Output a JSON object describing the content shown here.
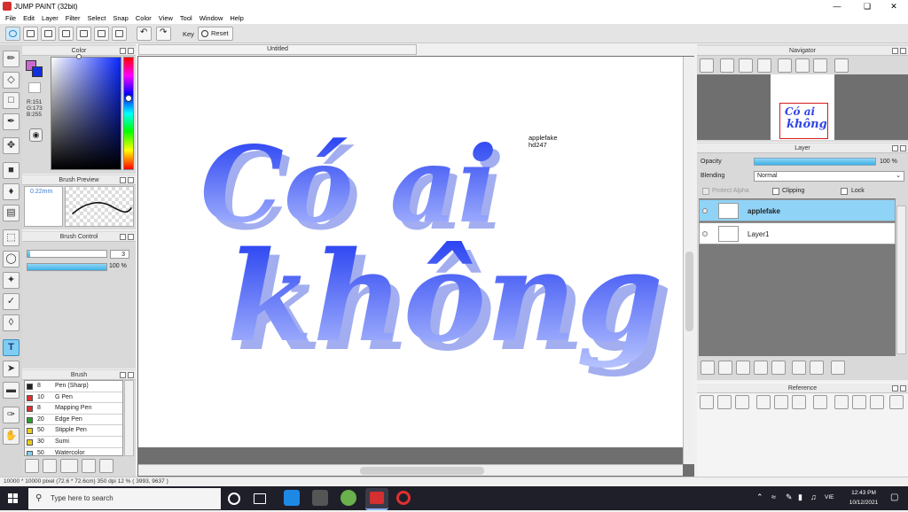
{
  "window": {
    "title": "JUMP PAINT (32bit)"
  },
  "menu": [
    "File",
    "Edit",
    "Layer",
    "Filter",
    "Select",
    "Snap",
    "Color",
    "View",
    "Tool",
    "Window",
    "Help"
  ],
  "toolbar": {
    "key_label": "Key",
    "reset_label": "Reset"
  },
  "panels": {
    "color": {
      "title": "Color",
      "rgb": [
        "R:151",
        "G:173",
        "B:255"
      ]
    },
    "brush_preview": {
      "title": "Brush Preview",
      "size": "0.22mm"
    },
    "brush_control": {
      "title": "Brush Control",
      "size_value": "3",
      "opacity_value": "100 %",
      "size_level": 0.03,
      "opacity_level": 1.0
    },
    "brush": {
      "title": "Brush",
      "items": [
        {
          "size": "8",
          "name": "Pen (Sharp)",
          "color": "#222222"
        },
        {
          "size": "10",
          "name": "G Pen",
          "color": "#e03030"
        },
        {
          "size": "8",
          "name": "Mapping Pen",
          "color": "#e03030"
        },
        {
          "size": "20",
          "name": "Edge Pen",
          "color": "#2aa02a"
        },
        {
          "size": "50",
          "name": "Stipple Pen",
          "color": "#e8d020"
        },
        {
          "size": "30",
          "name": "Sumi",
          "color": "#e8d020"
        },
        {
          "size": "50",
          "name": "Watercolor",
          "color": "#7fd0f0"
        }
      ]
    },
    "canvas": {
      "tab": "Untitled",
      "text_line1": "Có ai",
      "text_line2": "không",
      "watermark1": "applefake",
      "watermark2": "hd247"
    },
    "navigator": {
      "title": "Navigator"
    },
    "layer": {
      "title": "Layer",
      "opacity_label": "Opacity",
      "opacity_value": "100 %",
      "blending_label": "Blending",
      "blending_value": "Normal",
      "protect_alpha": "Protect Alpha",
      "clipping": "Clipping",
      "lock": "Lock",
      "layers": [
        {
          "name": "applefake",
          "selected": true
        },
        {
          "name": "Layer1",
          "selected": false
        }
      ]
    },
    "reference": {
      "title": "Reference"
    }
  },
  "status": {
    "text": "10000 * 10000 pixel  (72.6 * 72.6cm)  350 dpi  12 %  ( 3993, 9637 )"
  },
  "taskbar": {
    "search_placeholder": "Type here to search",
    "lang": "VIE",
    "time": "12:43 PM",
    "date": "10/12/2021"
  },
  "colors": {
    "accent": "#3fb1e6",
    "text_gradient_top": "#1e3df0",
    "text_gradient_bottom": "#b8c4ff",
    "text_shadow": "#9da9ee"
  }
}
